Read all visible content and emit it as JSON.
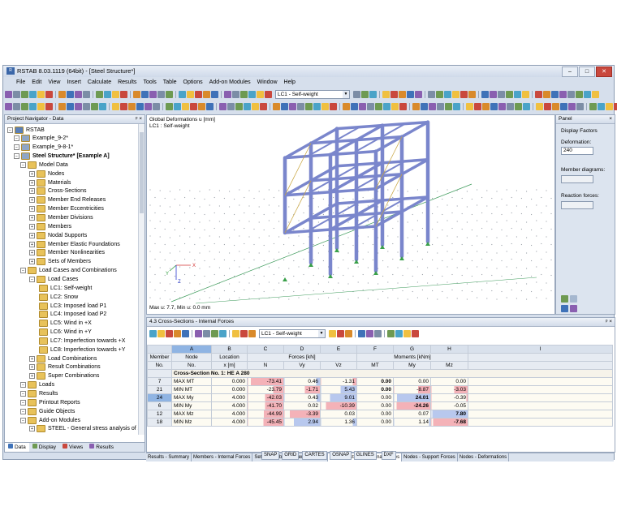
{
  "window": {
    "title": "RSTAB 8.03.1119 (64bit) - [Steel Structure*]"
  },
  "menu": [
    "File",
    "Edit",
    "View",
    "Insert",
    "Calculate",
    "Results",
    "Tools",
    "Table",
    "Options",
    "Add-on Modules",
    "Window",
    "Help"
  ],
  "toolbar": {
    "load_case": "LC1 - Self-weight"
  },
  "navigator": {
    "title": "Project Navigator - Data",
    "items": [
      {
        "label": "RSTAB",
        "level": 0
      },
      {
        "label": "Example_9-2*",
        "level": 1
      },
      {
        "label": "Example_9-8-1*",
        "level": 1
      },
      {
        "label": "Steel Structure* [Example A]",
        "level": 1,
        "bold": true
      },
      {
        "label": "Model Data",
        "level": 2
      },
      {
        "label": "Nodes",
        "level": 3
      },
      {
        "label": "Materials",
        "level": 3
      },
      {
        "label": "Cross-Sections",
        "level": 3
      },
      {
        "label": "Member End Releases",
        "level": 3
      },
      {
        "label": "Member Eccentricities",
        "level": 3
      },
      {
        "label": "Member Divisions",
        "level": 3
      },
      {
        "label": "Members",
        "level": 3
      },
      {
        "label": "Nodal Supports",
        "level": 3
      },
      {
        "label": "Member Elastic Foundations",
        "level": 3
      },
      {
        "label": "Member Nonlinearities",
        "level": 3
      },
      {
        "label": "Sets of Members",
        "level": 3
      },
      {
        "label": "Load Cases and Combinations",
        "level": 2
      },
      {
        "label": "Load Cases",
        "level": 3
      },
      {
        "label": "LC1: Self-weight",
        "level": 4
      },
      {
        "label": "LC2: Snow",
        "level": 4
      },
      {
        "label": "LC3: Imposed load P1",
        "level": 4
      },
      {
        "label": "LC4: Imposed load P2",
        "level": 4
      },
      {
        "label": "LC5: Wind in +X",
        "level": 4
      },
      {
        "label": "LC6: Wind in +Y",
        "level": 4
      },
      {
        "label": "LC7: Imperfection towards +X",
        "level": 4
      },
      {
        "label": "LC8: Imperfection towards +Y",
        "level": 4
      },
      {
        "label": "Load Combinations",
        "level": 3
      },
      {
        "label": "Result Combinations",
        "level": 3
      },
      {
        "label": "Super Combinations",
        "level": 3
      },
      {
        "label": "Loads",
        "level": 2
      },
      {
        "label": "Results",
        "level": 2
      },
      {
        "label": "Printout Reports",
        "level": 2
      },
      {
        "label": "Guide Objects",
        "level": 2
      },
      {
        "label": "Add-on Modules",
        "level": 2
      },
      {
        "label": "STEEL - General stress analysis of s",
        "level": 3
      }
    ],
    "tabs": [
      "Data",
      "Display",
      "Views",
      "Results"
    ]
  },
  "viewport": {
    "line1": "Global Deformations u [mm]",
    "line2": "LC1 : Self-weight",
    "footer": "Max u: 7.7, Min u: 0.0 mm",
    "axes": [
      "X",
      "Y",
      "Z"
    ]
  },
  "panel": {
    "title": "Panel",
    "section": "Display Factors",
    "deformation_label": "Deformation:",
    "deformation_value": "240",
    "member_diagrams_label": "Member diagrams:",
    "reaction_forces_label": "Reaction forces:"
  },
  "table": {
    "title": "4.3 Cross-Sections - Internal Forces",
    "load_case": "LC1 - Self-weight",
    "col_letters": [
      "A",
      "B",
      "C",
      "D",
      "E",
      "F",
      "G",
      "H",
      "I"
    ],
    "group_row": [
      "Member",
      "Node",
      "Location",
      "Forces [kN]",
      "",
      "",
      "Moments [kNm]",
      "",
      ""
    ],
    "unit_row": [
      "No.",
      "No.",
      "x [m]",
      "N",
      "Vy",
      "Vz",
      "MT",
      "My",
      "Mz"
    ],
    "section_title": "Cross-Section No. 1: HE A 280",
    "rows": [
      {
        "member": "7",
        "node": "MAX MT",
        "x": "0.000",
        "N": "-73.41",
        "Vy": "0.46",
        "Vz": "-1.31",
        "MT": "0.00",
        "My": "0.00",
        "Mz": "0.00",
        "bold": "MT"
      },
      {
        "member": "21",
        "node": "MIN MT",
        "x": "0.000",
        "N": "-23.79",
        "Vy": "-1.71",
        "Vz": "5.43",
        "MT": "0.00",
        "My": "-8.87",
        "Mz": "-3.03",
        "bold": "MT"
      },
      {
        "member": "24",
        "node": "MAX My",
        "x": "4.000",
        "N": "-42.03",
        "Vy": "0.43",
        "Vz": "9.01",
        "MT": "0.00",
        "My": "24.01",
        "Mz": "-0.39",
        "bold": "My"
      },
      {
        "member": "6",
        "node": "MIN My",
        "x": "4.000",
        "N": "-41.70",
        "Vy": "0.02",
        "Vz": "-10.39",
        "MT": "0.00",
        "My": "-24.26",
        "Mz": "-0.05",
        "bold": "My"
      },
      {
        "member": "12",
        "node": "MAX Mz",
        "x": "4.000",
        "N": "-44.99",
        "Vy": "-3.39",
        "Vz": "0.03",
        "MT": "0.00",
        "My": "0.07",
        "Mz": "7.80",
        "bold": "Mz"
      },
      {
        "member": "18",
        "node": "MIN Mz",
        "x": "4.000",
        "N": "-45.45",
        "Vy": "2.94",
        "Vz": "1.36",
        "MT": "0.00",
        "My": "1.14",
        "Mz": "-7.68",
        "bold": "Mz"
      }
    ]
  },
  "sheet_tabs": [
    "Results - Summary",
    "Members - Internal Forces",
    "Set of Members - Internal Forces",
    "Cross-Sections - Internal Forces",
    "Nodes - Support Forces",
    "Nodes - Deformations"
  ],
  "status_buttons": [
    "SNAP",
    "GRID",
    "CARTES",
    "OSNAP",
    "GLINES",
    "DXF"
  ]
}
